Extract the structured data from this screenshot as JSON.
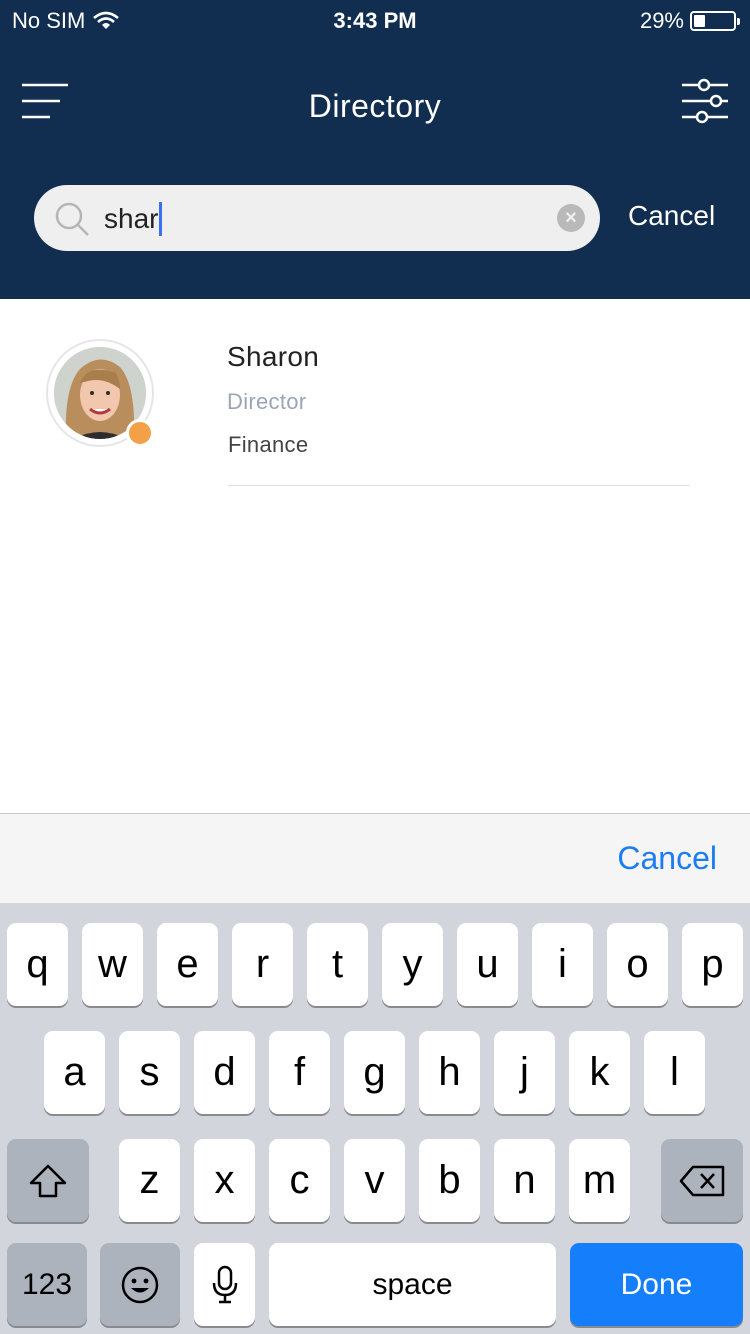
{
  "status_bar": {
    "carrier": "No SIM",
    "time": "3:43 PM",
    "battery_percent": "29%",
    "battery_level": 0.29
  },
  "header": {
    "title": "Directory",
    "menu_icon": "hamburger-menu-icon",
    "filter_icon": "sliders-filter-icon"
  },
  "search": {
    "value": "shar",
    "cancel_label": "Cancel"
  },
  "results": [
    {
      "name": "Sharon",
      "title": "Director",
      "department": "Finance",
      "presence_color": "#f4a049"
    }
  ],
  "accessory": {
    "cancel_label": "Cancel"
  },
  "keyboard": {
    "row1": [
      "q",
      "w",
      "e",
      "r",
      "t",
      "y",
      "u",
      "i",
      "o",
      "p"
    ],
    "row2": [
      "a",
      "s",
      "d",
      "f",
      "g",
      "h",
      "j",
      "k",
      "l"
    ],
    "row3": [
      "z",
      "x",
      "c",
      "v",
      "b",
      "n",
      "m"
    ],
    "numbers_label": "123",
    "space_label": "space",
    "done_label": "Done"
  },
  "colors": {
    "header_bg": "#112d4f",
    "accent_blue": "#147efb",
    "presence_away": "#f4a049"
  }
}
